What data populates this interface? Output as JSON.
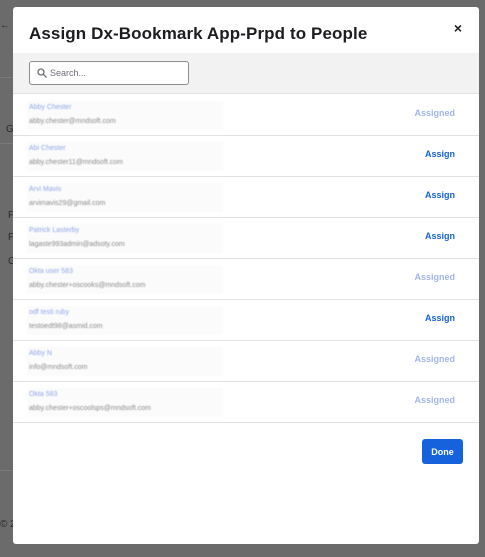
{
  "background": {
    "fragments": [
      "← s",
      "G",
      "F",
      "F",
      "G",
      "© 2"
    ]
  },
  "modal": {
    "title": "Assign Dx-Bookmark App-Prpd to People",
    "close_glyph": "×",
    "search": {
      "placeholder": "Search..."
    },
    "people": [
      {
        "name": "Abby Chester",
        "email": "abby.chester@mndsoft.com",
        "status": "Assigned"
      },
      {
        "name": "Abi Chester",
        "email": "abby.chester11@mndsoft.com",
        "status": "Assign"
      },
      {
        "name": "Arvi Mavis",
        "email": "arvimavis29@gmail.com",
        "status": "Assign"
      },
      {
        "name": "Patrick Lasterby",
        "email": "lagaste993admin@adsoty.com",
        "status": "Assign"
      },
      {
        "name": "Okta user 583",
        "email": "abby.chester+oscooks@mndsoft.com",
        "status": "Assigned"
      },
      {
        "name": "odf testi ruby",
        "email": "testoedt98@asmid.com",
        "status": "Assign"
      },
      {
        "name": "Abby N",
        "email": "info@mndsoft.com",
        "status": "Assigned"
      },
      {
        "name": "Okta 583",
        "email": "abby.chester+oscoolsps@mndsoft.com",
        "status": "Assigned"
      }
    ],
    "done_label": "Done"
  },
  "colors": {
    "accent": "#1662dd",
    "assigned": "#a3b6e8",
    "overlay": "#6b6b6b"
  }
}
